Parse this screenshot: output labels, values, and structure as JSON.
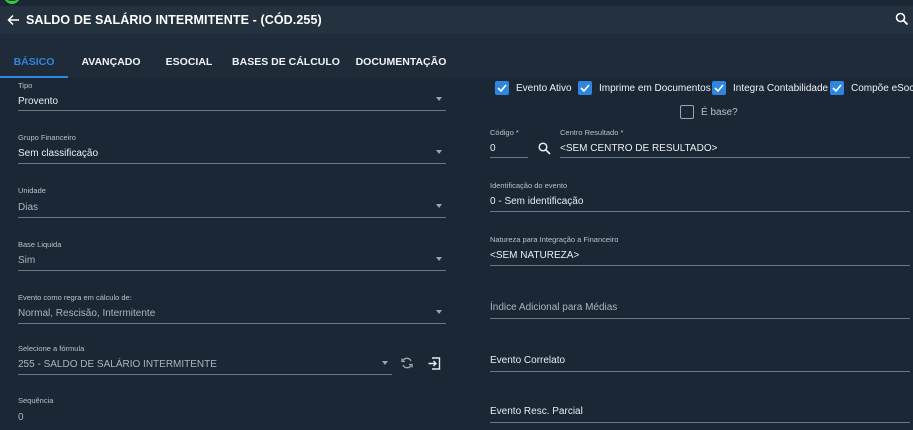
{
  "header": {
    "title": "SALDO DE SALÁRIO INTERMITENTE - (CÓD.255)"
  },
  "tabs": [
    {
      "label": "BÁSICO",
      "active": true
    },
    {
      "label": "AVANÇADO",
      "active": false
    },
    {
      "label": "ESOCIAL",
      "active": false
    },
    {
      "label": "BASES DE CÁLCULO",
      "active": false
    },
    {
      "label": "DOCUMENTAÇÃO",
      "active": false
    }
  ],
  "left": {
    "tipo": {
      "label": "Tipo",
      "value": "Provento"
    },
    "grupo": {
      "label": "Grupo Financeiro",
      "value": "Sem classificação"
    },
    "unidade": {
      "label": "Unidade",
      "value": "Dias"
    },
    "base_liquida": {
      "label": "Base Liquida",
      "value": "Sim"
    },
    "regra": {
      "label": "Evento como regra em cálculo de:",
      "value": "Normal, Rescisão, Intermitente"
    },
    "formula": {
      "label": "Selecione a fórmula",
      "value": "255 - SALDO DE SALÁRIO INTERMITENTE"
    },
    "sequencia": {
      "label": "Sequência",
      "value": "0"
    }
  },
  "checks": [
    {
      "label": "Evento Ativo",
      "checked": true
    },
    {
      "label": "Imprime em Documentos",
      "checked": true
    },
    {
      "label": "Integra Contabilidade",
      "checked": true
    },
    {
      "label": "Compõe eSoc",
      "checked": true
    },
    {
      "label": "É base?",
      "checked": false
    }
  ],
  "right": {
    "codigo": {
      "label": "Código *",
      "value": "0"
    },
    "centro": {
      "label": "Centro Resultado *",
      "value": "<SEM CENTRO DE RESULTADO>"
    },
    "identificacao": {
      "label": "Identificação do evento",
      "value": "0 - Sem identificação"
    },
    "natureza": {
      "label": "Natureza para Integração a Financeiro",
      "value": "<SEM NATUREZA>"
    },
    "indice": {
      "placeholder": "Índice Adicional para Médias"
    },
    "correlato": {
      "value": "Evento Correlato"
    },
    "resc_parcial": {
      "value": "Evento Resc. Parcial"
    }
  },
  "colors": {
    "accent": "#2e86de",
    "background": "#1b2735",
    "header": "#24313f"
  }
}
